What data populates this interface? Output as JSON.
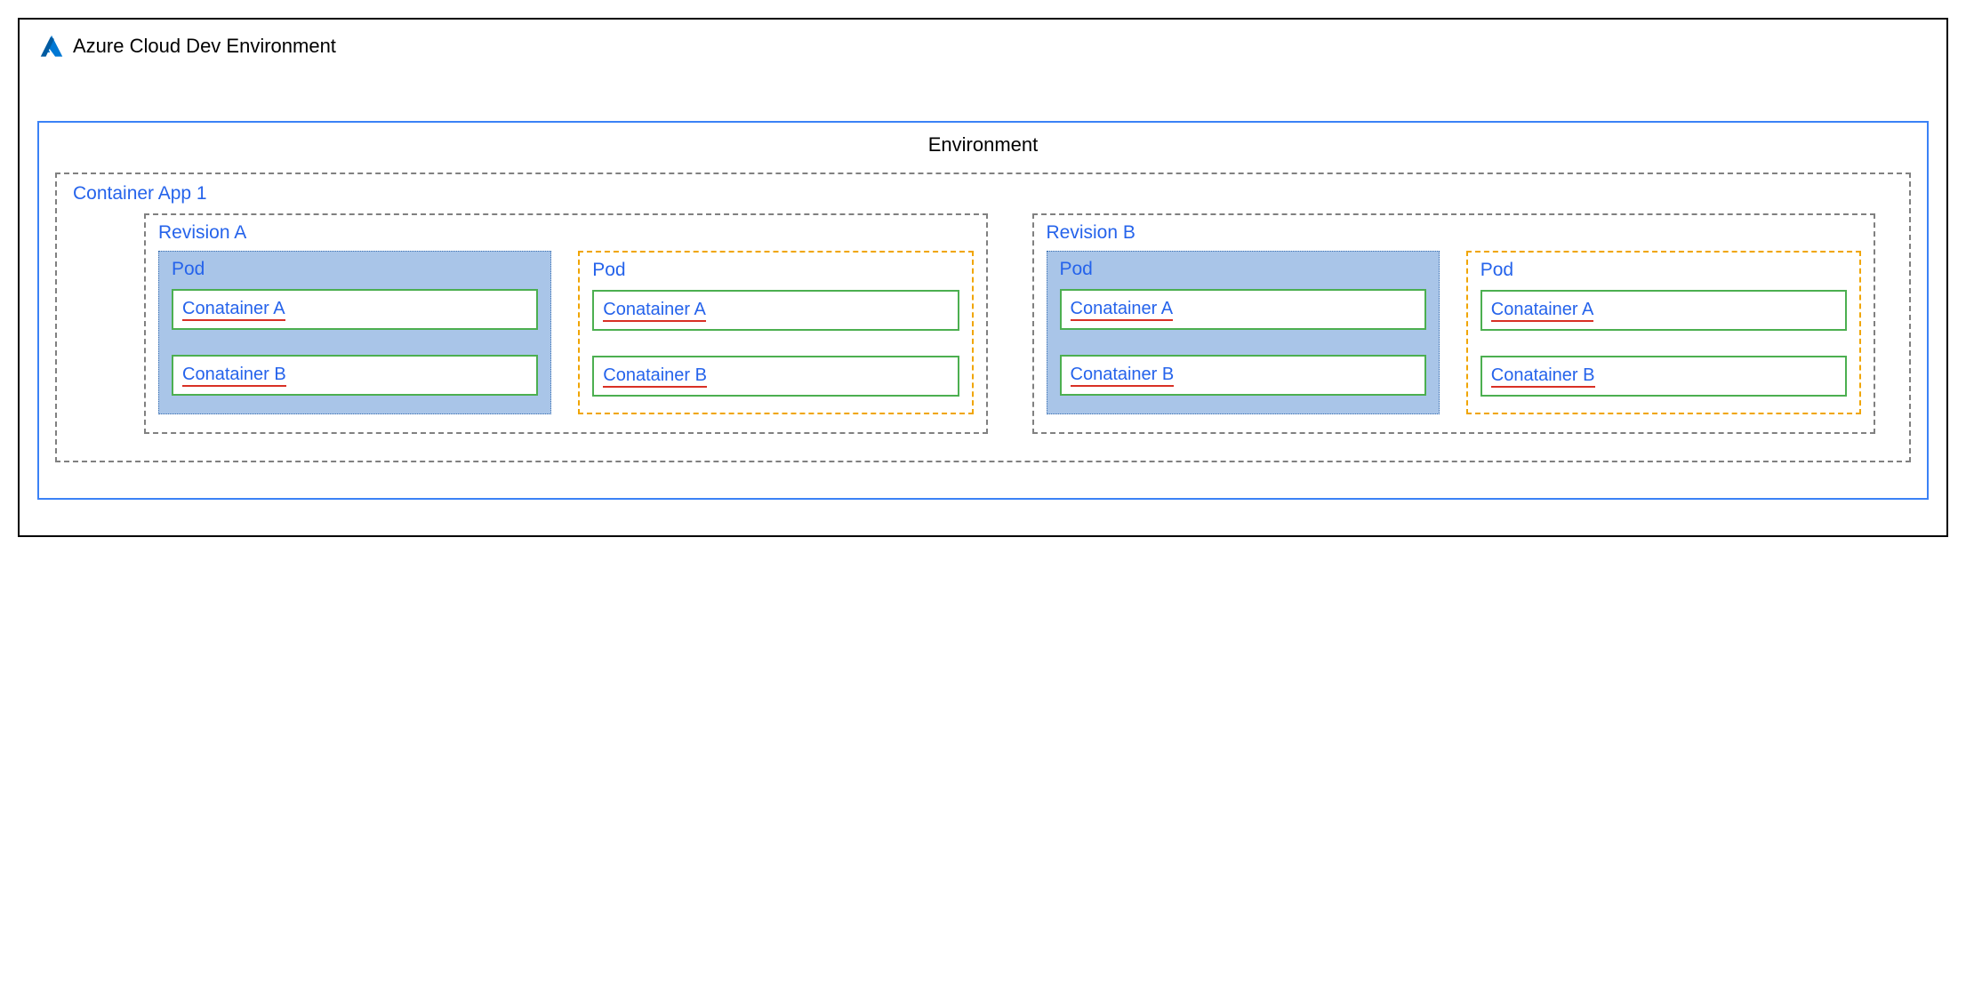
{
  "cloud": {
    "title": "Azure Cloud Dev Environment"
  },
  "environment": {
    "title": "Environment",
    "containerApp": {
      "title": "Container App 1",
      "revisions": [
        {
          "title": "Revision A",
          "pods": [
            {
              "title": "Pod",
              "style": "filled",
              "containers": [
                {
                  "label": "Conatainer A"
                },
                {
                  "label": "Conatainer B"
                }
              ]
            },
            {
              "title": "Pod",
              "style": "dashed",
              "containers": [
                {
                  "label": "Conatainer A"
                },
                {
                  "label": "Conatainer B"
                }
              ]
            }
          ]
        },
        {
          "title": "Revision B",
          "pods": [
            {
              "title": "Pod",
              "style": "filled",
              "containers": [
                {
                  "label": "Conatainer A"
                },
                {
                  "label": "Conatainer B"
                }
              ]
            },
            {
              "title": "Pod",
              "style": "dashed",
              "containers": [
                {
                  "label": "Conatainer A"
                },
                {
                  "label": "Conatainer B"
                }
              ]
            }
          ]
        }
      ]
    }
  }
}
